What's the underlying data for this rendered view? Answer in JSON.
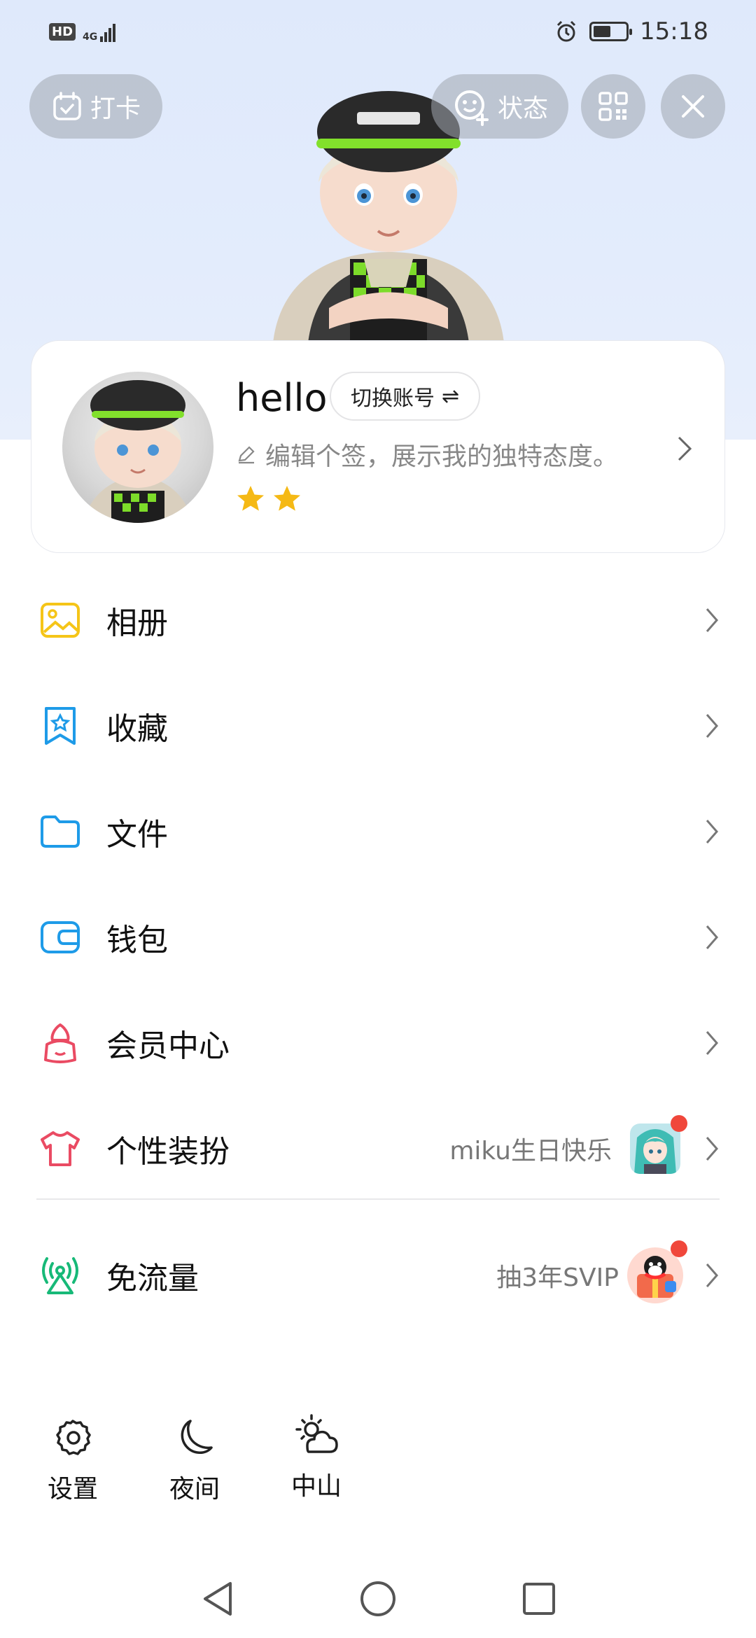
{
  "status_bar": {
    "hd": "HD",
    "network": "4G",
    "time": "15:18"
  },
  "top_buttons": {
    "checkin_label": "打卡",
    "status_label": "状态"
  },
  "profile": {
    "username": "hello",
    "switch_account_label": "切换账号",
    "switch_icon": "⇌",
    "signature_placeholder": "编辑个签，展示我的独特态度。",
    "stars": 2
  },
  "menu": {
    "items": [
      {
        "label": "相册",
        "icon": "album-icon",
        "color": "#f5c518"
      },
      {
        "label": "收藏",
        "icon": "favorites-icon",
        "color": "#1e9be8"
      },
      {
        "label": "文件",
        "icon": "folder-icon",
        "color": "#1e9be8"
      },
      {
        "label": "钱包",
        "icon": "wallet-icon",
        "color": "#1e9be8"
      },
      {
        "label": "会员中心",
        "icon": "vip-icon",
        "color": "#ea4b63"
      },
      {
        "label": "个性装扮",
        "icon": "dressup-icon",
        "color": "#ea4b63",
        "extra": "miku生日快乐"
      },
      {
        "label": "免流量",
        "icon": "free-data-icon",
        "color": "#17b978",
        "extra": "抽3年SVIP"
      }
    ]
  },
  "shortcuts": {
    "settings": "设置",
    "night": "夜间",
    "weather": "中山"
  },
  "colors": {
    "header_bg": "#dfe9fb",
    "badge_red": "#f0473b",
    "star_gold": "#f5b915"
  }
}
